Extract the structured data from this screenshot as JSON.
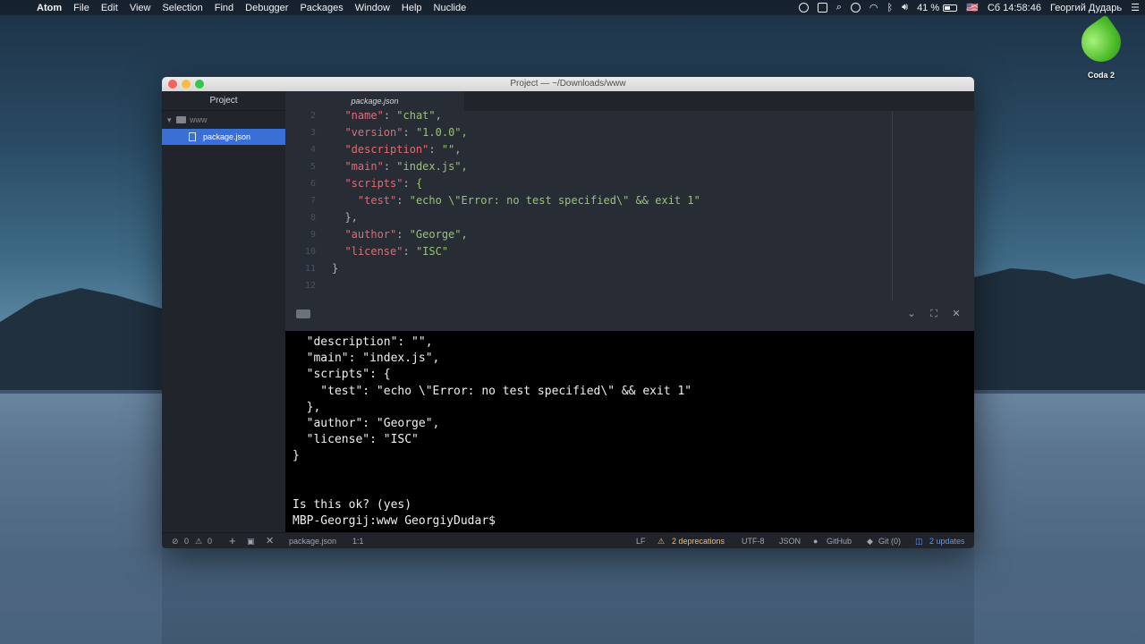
{
  "menubar": {
    "apple_glyph": "",
    "items": [
      "Atom",
      "File",
      "Edit",
      "View",
      "Selection",
      "Find",
      "Debugger",
      "Packages",
      "Window",
      "Help",
      "Nuclide"
    ],
    "battery": "41 %",
    "flag": "🇺🇸",
    "datetime": "Сб 14:58:46",
    "user": "Георгий Дударь",
    "list_glyph": "☰"
  },
  "desktop": {
    "icon_label": "Coda 2"
  },
  "window": {
    "title": "Project — ~/Downloads/www"
  },
  "sidebar": {
    "header": "Project",
    "folder": "www",
    "file": "package.json"
  },
  "tab": {
    "label": "package.json"
  },
  "editor": {
    "lines": [
      {
        "n": "2",
        "text": "  \"name\": \"chat\","
      },
      {
        "n": "3",
        "text": "  \"version\": \"1.0.0\","
      },
      {
        "n": "4",
        "text": "  \"description\": \"\","
      },
      {
        "n": "5",
        "text": "  \"main\": \"index.js\","
      },
      {
        "n": "6",
        "text": "  \"scripts\": {"
      },
      {
        "n": "7",
        "text": "    \"test\": \"echo \\\"Error: no test specified\\\" && exit 1\""
      },
      {
        "n": "8",
        "text": "  },"
      },
      {
        "n": "9",
        "text": "  \"author\": \"George\","
      },
      {
        "n": "10",
        "text": "  \"license\": \"ISC\""
      },
      {
        "n": "11",
        "text": "}"
      },
      {
        "n": "12",
        "text": ""
      }
    ]
  },
  "terminal": {
    "controls": {
      "collapse": "⌄",
      "maximize": "⛶",
      "close": "✕"
    },
    "lines": [
      "  \"description\": \"\",",
      "  \"main\": \"index.js\",",
      "  \"scripts\": {",
      "    \"test\": \"echo \\\"Error: no test specified\\\" && exit 1\"",
      "  },",
      "  \"author\": \"George\",",
      "  \"license\": \"ISC\"",
      "}",
      "",
      "",
      "Is this ok? (yes)",
      "MBP-Georgij:www GeorgiyDudar$"
    ]
  },
  "statusbar": {
    "errors": "0",
    "warnings": "0",
    "file": "package.json",
    "cursor": "1:1",
    "line_ending": "LF",
    "deprecations": "2 deprecations",
    "encoding": "UTF-8",
    "grammar": "JSON",
    "github": "GitHub",
    "git": "Git (0)",
    "updates": "2 updates"
  }
}
